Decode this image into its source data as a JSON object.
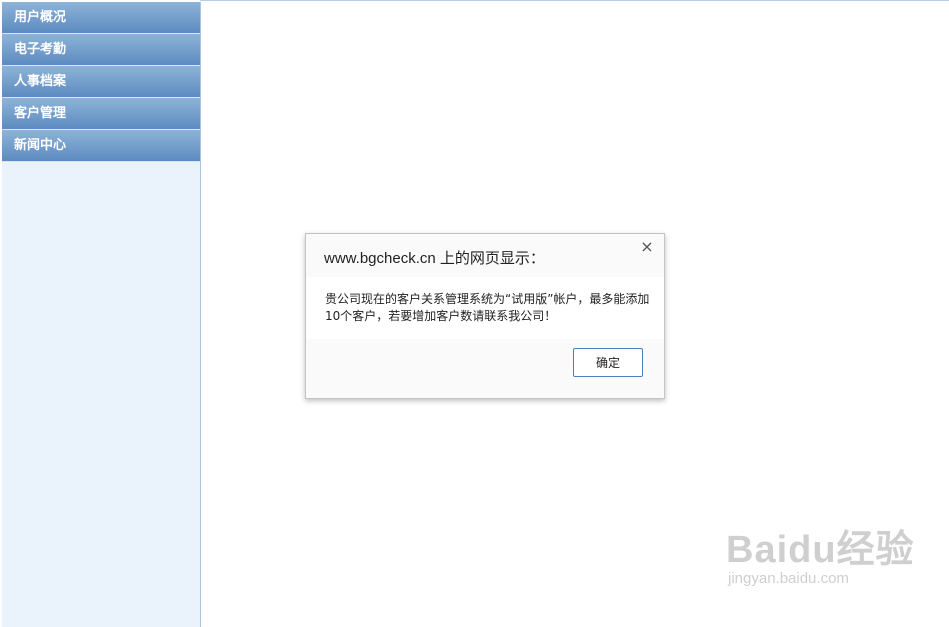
{
  "sidebar": {
    "items": [
      {
        "label": "用户概况"
      },
      {
        "label": "电子考勤"
      },
      {
        "label": "人事档案"
      },
      {
        "label": "客户管理"
      },
      {
        "label": "新闻中心"
      }
    ]
  },
  "dialog": {
    "title": "www.bgcheck.cn 上的网页显示：",
    "message": "贵公司现在的客户关系管理系统为“试用版”帐户，最多能添加10个客户，若要增加客户数请联系我公司！",
    "ok_label": "确定",
    "close_glyph": "×"
  },
  "watermark": {
    "brand": "Baidu经验",
    "url": "jingyan.baidu.com"
  }
}
